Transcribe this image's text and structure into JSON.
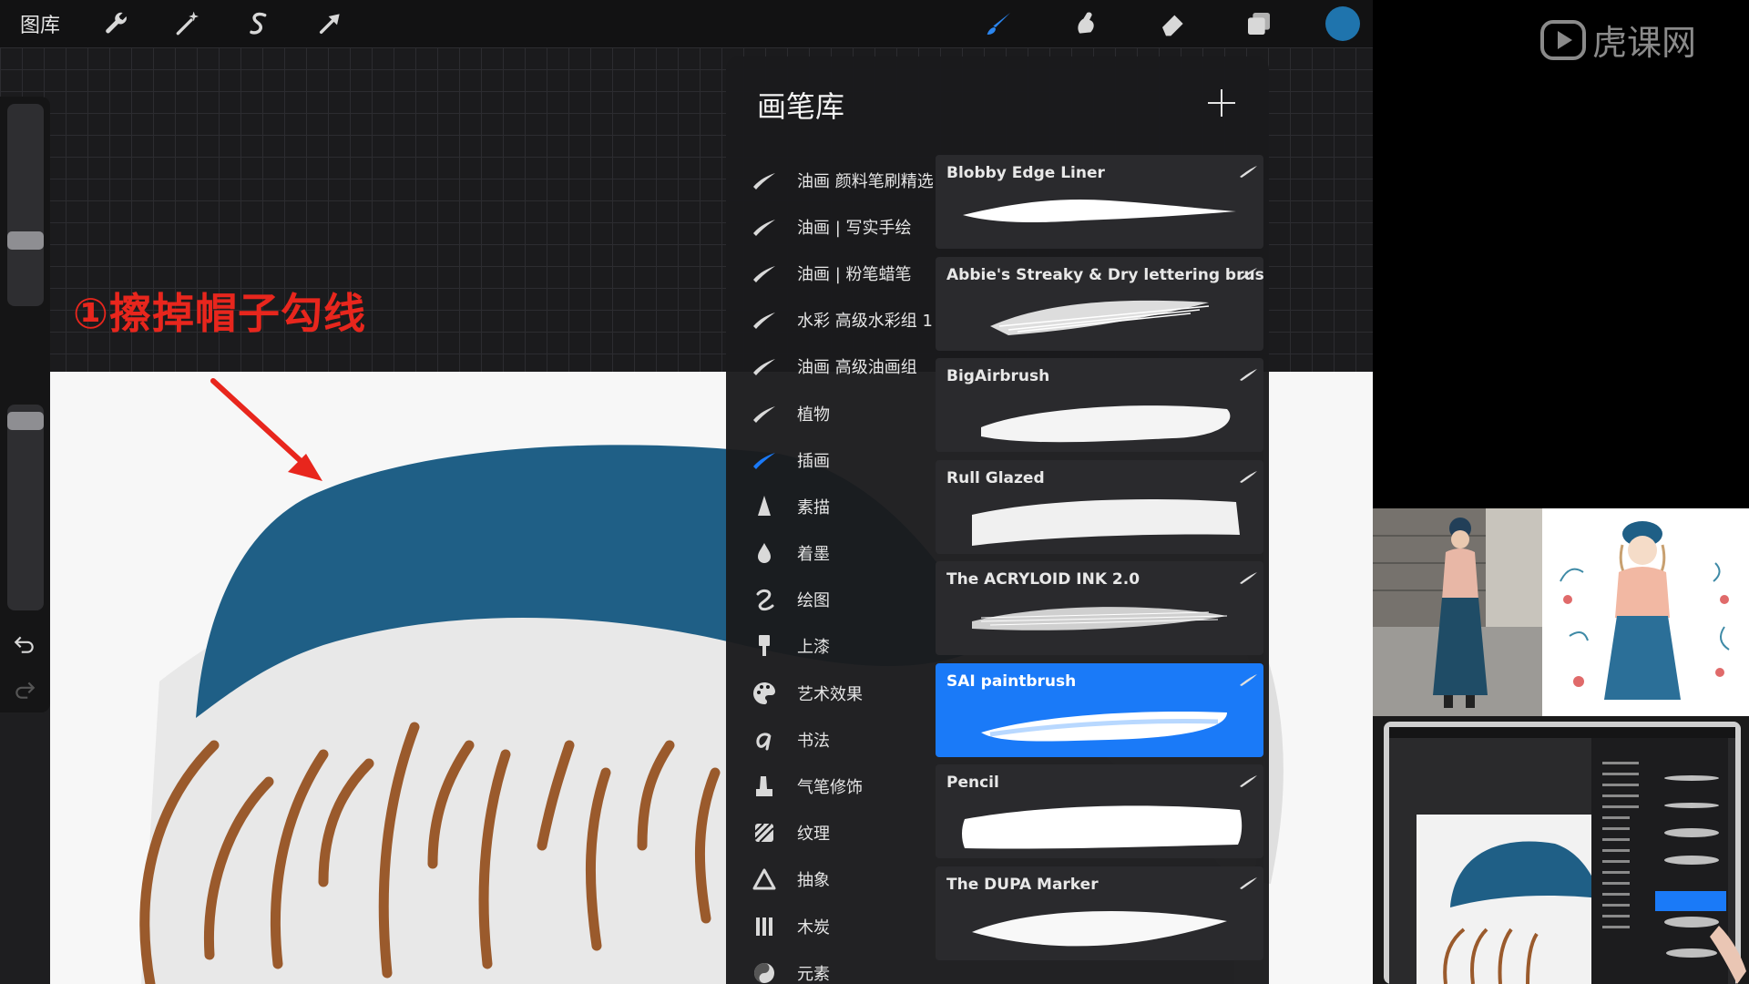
{
  "toolbar": {
    "gallery_label": "图库",
    "left_tools": [
      "wrench-icon",
      "magic-wand-icon",
      "selection-s-icon",
      "transform-arrow-icon"
    ],
    "right_tools": [
      "brush-icon",
      "smudge-icon",
      "eraser-icon",
      "layers-icon"
    ],
    "active_tool": "brush-icon",
    "current_color": "#1f74ad"
  },
  "annotation": {
    "text": "①擦掉帽子勾线",
    "color": "#e8261d"
  },
  "brush_library": {
    "title": "画笔库",
    "add_icon": "plus-icon",
    "brush_sets": [
      {
        "label": "油画 颜料笔刷精选",
        "icon": "brush-stroke-icon"
      },
      {
        "label": "油画 | 写实手绘",
        "icon": "brush-stroke-icon"
      },
      {
        "label": "油画 | 粉笔蜡笔",
        "icon": "brush-stroke-icon"
      },
      {
        "label": "水彩 高级水彩组 1",
        "icon": "brush-stroke-icon"
      },
      {
        "label": "油画 高级油画组",
        "icon": "brush-stroke-icon"
      },
      {
        "label": "植物",
        "icon": "brush-stroke-icon"
      },
      {
        "label": "插画",
        "icon": "brush-stroke-icon",
        "selected": true
      },
      {
        "label": "素描",
        "icon": "pencil-tip-icon"
      },
      {
        "label": "着墨",
        "icon": "ink-drop-icon"
      },
      {
        "label": "绘图",
        "icon": "squiggle-icon"
      },
      {
        "label": "上漆",
        "icon": "paint-brush-icon"
      },
      {
        "label": "艺术效果",
        "icon": "palette-icon"
      },
      {
        "label": "书法",
        "icon": "calligraphy-icon"
      },
      {
        "label": "气笔修饰",
        "icon": "airbrush-icon"
      },
      {
        "label": "纹理",
        "icon": "texture-icon"
      },
      {
        "label": "抽象",
        "icon": "triangle-icon"
      },
      {
        "label": "木炭",
        "icon": "charcoal-icon"
      },
      {
        "label": "元素",
        "icon": "yin-yang-icon"
      }
    ],
    "brushes": [
      {
        "name": "Blobby Edge  Liner"
      },
      {
        "name": "Abbie's Streaky & Dry lettering brush"
      },
      {
        "name": "BigAirbrush"
      },
      {
        "name": "Rull Glazed"
      },
      {
        "name": "The ACRYLOID INK 2.0"
      },
      {
        "name": "SAI paintbrush",
        "selected": true
      },
      {
        "name": "Pencil"
      },
      {
        "name": "The DUPA Marker"
      }
    ],
    "selected_color": "#1a7af8"
  },
  "watermark": {
    "text": "虎课网"
  }
}
